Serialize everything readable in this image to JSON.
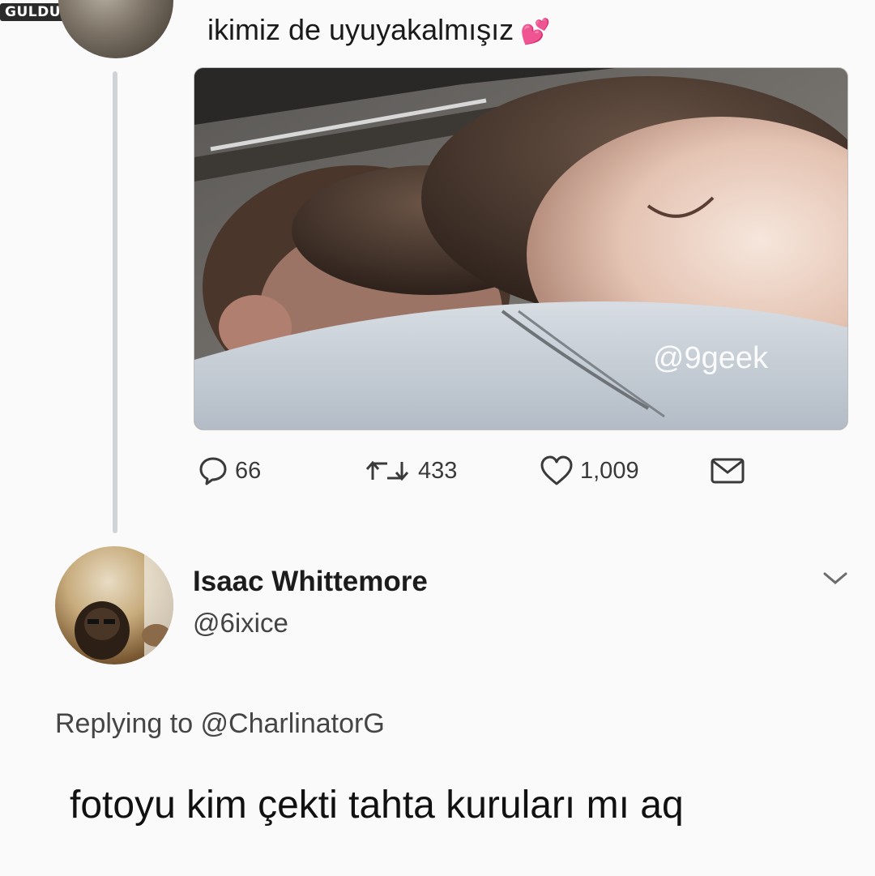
{
  "watermark": "GULDUM.NET",
  "tweet": {
    "text": "ikimiz de uyuyakalmışız",
    "emoji": "💕",
    "image_watermark": "@9geek"
  },
  "actions": {
    "replies": "66",
    "retweets": "433",
    "likes": "1,009"
  },
  "reply": {
    "name": "Isaac Whittemore",
    "handle": "@6ixice",
    "replying_to": "Replying to @CharlinatorG",
    "text": "fotoyu kim çekti tahta kuruları mı aq"
  },
  "icons": [
    "reply-icon",
    "retweet-icon",
    "like-icon",
    "message-icon",
    "chevron-down-icon"
  ]
}
